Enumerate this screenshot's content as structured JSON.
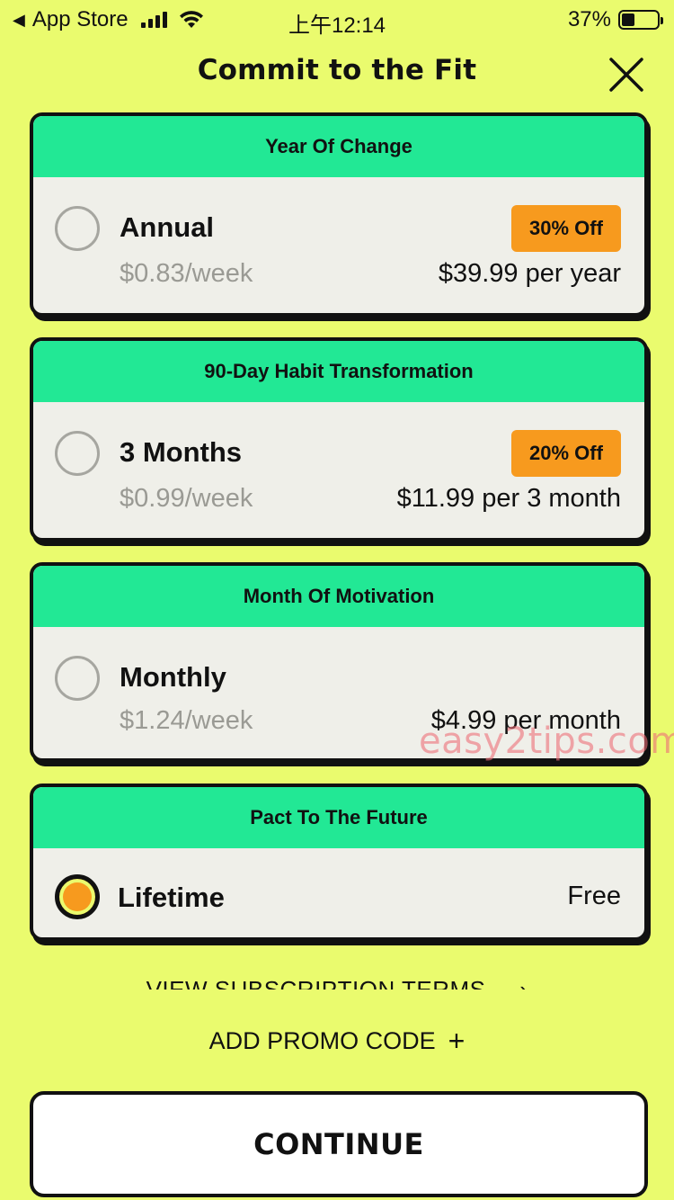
{
  "status_bar": {
    "back_label": "App Store",
    "time": "上午12:14",
    "battery_text": "37%",
    "battery_level": 0.37
  },
  "header": {
    "title": "Commit to the Fit",
    "close_icon": "close-icon"
  },
  "plans": [
    {
      "header": "Year Of Change",
      "name": "Annual",
      "weekly": "$0.83/week",
      "price": "$39.99 per year",
      "badge": "30% Off",
      "selected": false
    },
    {
      "header": "90-Day Habit Transformation",
      "name": "3 Months",
      "weekly": "$0.99/week",
      "price": "$11.99 per 3 month",
      "badge": "20% Off",
      "selected": false
    },
    {
      "header": "Month Of Motivation",
      "name": "Monthly",
      "weekly": "$1.24/week",
      "price": "$4.99 per month",
      "badge": "",
      "selected": false
    },
    {
      "header": "Pact To The Future",
      "name": "Lifetime",
      "weekly": "",
      "price": "Free",
      "badge": "",
      "selected": true
    }
  ],
  "links": {
    "terms": "VIEW SUBSCRIPTION TERMS",
    "terms_icon": "chevron-right-icon",
    "promo": "ADD PROMO CODE",
    "promo_icon": "plus-icon"
  },
  "continue_label": "CONTINUE",
  "watermark": "easy2tips.com",
  "colors": {
    "background": "#EAFB6E",
    "header_green": "#22E895",
    "badge_orange": "#F79A1E",
    "card_bg": "#EFEFE9"
  }
}
